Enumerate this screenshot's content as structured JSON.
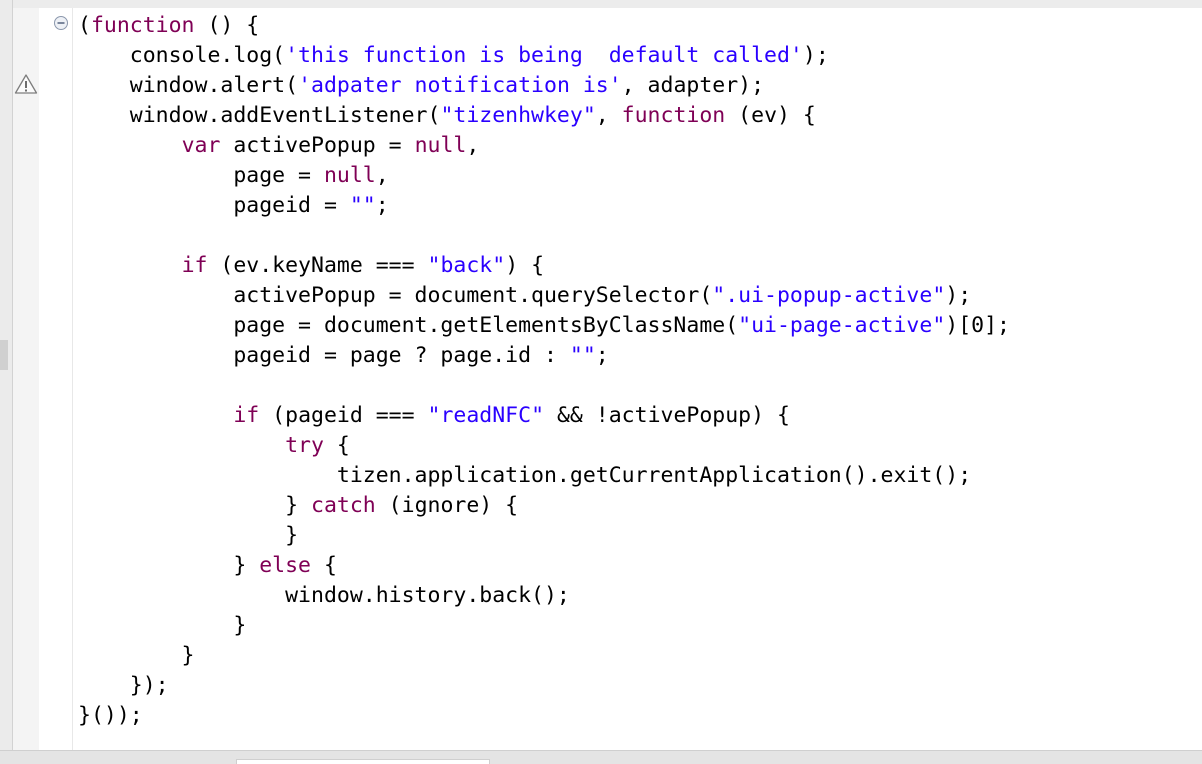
{
  "editor": {
    "gutter_icons": {
      "fold": "collapse-minus-icon",
      "warning": "warning-triangle-icon"
    },
    "lines": [
      [
        {
          "t": "p",
          "v": "("
        },
        {
          "t": "kw",
          "v": "function"
        },
        {
          "t": "p",
          "v": " () {"
        }
      ],
      [
        {
          "t": "p",
          "v": "    console.log("
        },
        {
          "t": "str",
          "v": "'this function is being  default called'"
        },
        {
          "t": "p",
          "v": ");"
        }
      ],
      [
        {
          "t": "p",
          "v": "    window.alert("
        },
        {
          "t": "str",
          "v": "'adpater notification is'"
        },
        {
          "t": "p",
          "v": ", adapter);"
        }
      ],
      [
        {
          "t": "p",
          "v": "    window.addEventListener("
        },
        {
          "t": "str",
          "v": "\"tizenhwkey\""
        },
        {
          "t": "p",
          "v": ", "
        },
        {
          "t": "kw",
          "v": "function"
        },
        {
          "t": "p",
          "v": " (ev) {"
        }
      ],
      [
        {
          "t": "p",
          "v": "        "
        },
        {
          "t": "kw",
          "v": "var"
        },
        {
          "t": "p",
          "v": " activePopup = "
        },
        {
          "t": "kw",
          "v": "null"
        },
        {
          "t": "p",
          "v": ","
        }
      ],
      [
        {
          "t": "p",
          "v": "            page = "
        },
        {
          "t": "kw",
          "v": "null"
        },
        {
          "t": "p",
          "v": ","
        }
      ],
      [
        {
          "t": "p",
          "v": "            pageid = "
        },
        {
          "t": "str",
          "v": "\"\""
        },
        {
          "t": "p",
          "v": ";"
        }
      ],
      [],
      [
        {
          "t": "p",
          "v": "        "
        },
        {
          "t": "kw",
          "v": "if"
        },
        {
          "t": "p",
          "v": " (ev.keyName === "
        },
        {
          "t": "str",
          "v": "\"back\""
        },
        {
          "t": "p",
          "v": ") {"
        }
      ],
      [
        {
          "t": "p",
          "v": "            activePopup = document.querySelector("
        },
        {
          "t": "str",
          "v": "\".ui-popup-active\""
        },
        {
          "t": "p",
          "v": ");"
        }
      ],
      [
        {
          "t": "p",
          "v": "            page = document.getElementsByClassName("
        },
        {
          "t": "str",
          "v": "\"ui-page-active\""
        },
        {
          "t": "p",
          "v": ")[0];"
        }
      ],
      [
        {
          "t": "p",
          "v": "            pageid = page ? page.id : "
        },
        {
          "t": "str",
          "v": "\"\""
        },
        {
          "t": "p",
          "v": ";"
        }
      ],
      [],
      [
        {
          "t": "p",
          "v": "            "
        },
        {
          "t": "kw",
          "v": "if"
        },
        {
          "t": "p",
          "v": " (pageid === "
        },
        {
          "t": "str",
          "v": "\"readNFC\""
        },
        {
          "t": "p",
          "v": " && !activePopup) {"
        }
      ],
      [
        {
          "t": "p",
          "v": "                "
        },
        {
          "t": "kw",
          "v": "try"
        },
        {
          "t": "p",
          "v": " {"
        }
      ],
      [
        {
          "t": "p",
          "v": "                    tizen.application.getCurrentApplication().exit();"
        }
      ],
      [
        {
          "t": "p",
          "v": "                } "
        },
        {
          "t": "kw",
          "v": "catch"
        },
        {
          "t": "p",
          "v": " (ignore) {"
        }
      ],
      [
        {
          "t": "p",
          "v": "                }"
        }
      ],
      [
        {
          "t": "p",
          "v": "            } "
        },
        {
          "t": "kw",
          "v": "else"
        },
        {
          "t": "p",
          "v": " {"
        }
      ],
      [
        {
          "t": "p",
          "v": "                window.history.back();"
        }
      ],
      [
        {
          "t": "p",
          "v": "            }"
        }
      ],
      [
        {
          "t": "p",
          "v": "        }"
        }
      ],
      [
        {
          "t": "p",
          "v": "    });"
        }
      ],
      [
        {
          "t": "p",
          "v": "}());"
        }
      ]
    ]
  }
}
